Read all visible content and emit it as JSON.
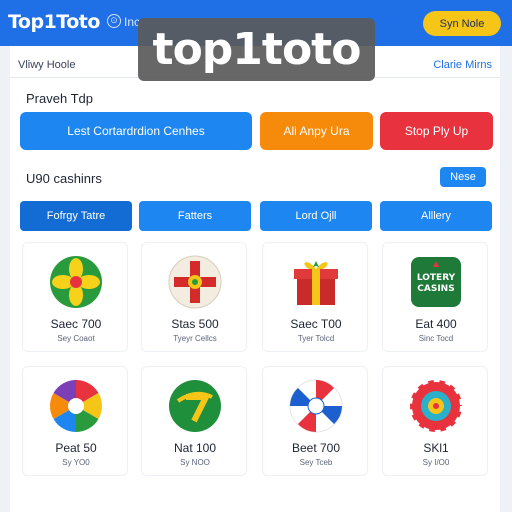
{
  "header": {
    "logo": "Top1Toto",
    "nav_icon": "clock-icon",
    "nav_text": "Inc",
    "signup_label": "Syn Nole"
  },
  "watermark": "top1toto",
  "subbar": {
    "left": "Vliwy Hoole",
    "right": "Clarie Mirns"
  },
  "popular": {
    "title": "Praveh Tdp",
    "buttons": [
      {
        "label": "Lest Cortardrdion Cenhes",
        "color": "#1e86f0"
      },
      {
        "label": "Ali Anpy Ura",
        "color": "#f58a0b"
      },
      {
        "label": "Stop Ply Up",
        "color": "#e8333f"
      }
    ]
  },
  "cashinrs": {
    "title": "U90 cashinrs",
    "more_label": "Nese",
    "tabs": [
      {
        "label": "Fofrgy Tatre"
      },
      {
        "label": "Fatters"
      },
      {
        "label": "Lord Ojll"
      },
      {
        "label": "Alllery"
      }
    ]
  },
  "games": [
    {
      "name": "Saec 700",
      "sub": "Sey Coaot",
      "icon": "star-flower-icon"
    },
    {
      "name": "Stas 500",
      "sub": "Tyeyr Cellcs",
      "icon": "cross-shield-icon"
    },
    {
      "name": "Saec T00",
      "sub": "Tyer Tolcd",
      "icon": "gift-box-icon"
    },
    {
      "name": "Eat 400",
      "sub": "Sinc Tocd",
      "icon": "lotery-casino-logo"
    },
    {
      "name": "Peat 50",
      "sub": "Sy YO0",
      "icon": "color-wheel-icon"
    },
    {
      "name": "Nat 100",
      "sub": "Sy NOO",
      "icon": "green-seven-icon"
    },
    {
      "name": "Beet 700",
      "sub": "Sey Tceb",
      "icon": "swirl-ball-icon"
    },
    {
      "name": "SKl1",
      "sub": "Sy I/O0",
      "icon": "roulette-wheel-icon"
    }
  ],
  "logo_text": [
    "LOTERY",
    "CASINS"
  ]
}
